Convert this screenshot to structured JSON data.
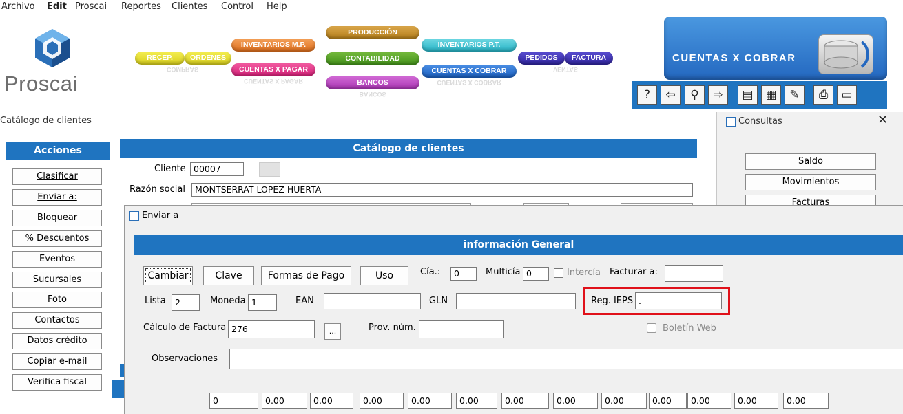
{
  "menu": [
    "Archivo",
    "Edit",
    "Proscai",
    "Reportes",
    "Clientes",
    "Control",
    "Help"
  ],
  "brand": "Proscai",
  "modules": {
    "recep": "RECEP.",
    "ordenes": "ORDENES",
    "compras": "COMPRAS",
    "inventarios_mp": "INVENTARIOS M.P.",
    "cuentas_pagar": "CUENTAS X PAGAR",
    "produccion": "PRODUCCIÓN",
    "contabilidad": "CONTABILIDAD",
    "bancos": "BANCOS",
    "inventarios_pt": "INVENTARIOS P.T.",
    "cuentas_cobrar": "CUENTAS X COBRAR",
    "pedidos": "PEDIDOS",
    "factura": "FACTURA",
    "ventas": "VENTAS",
    "big_module": "CUENTAS X COBRAR"
  },
  "toolbar_icons": [
    "help-icon",
    "arrow-left-icon",
    "search-icon",
    "arrow-right-icon",
    "list-icon",
    "edit-doc-icon",
    "pencil-icon",
    "print-icon",
    "window-icon"
  ],
  "window_title": "Catálogo de clientes",
  "actions": {
    "title": "Acciones",
    "items": [
      "Clasificar",
      "Enviar a:",
      "Bloquear",
      "% Descuentos",
      "Eventos",
      "Sucursales",
      "Foto",
      "Contactos",
      "Datos crédito",
      "Copiar e-mail",
      "Verifica fiscal"
    ]
  },
  "catalog": {
    "title": "Catálogo de clientes",
    "cliente_label": "Cliente",
    "cliente_value": "00007",
    "razon_label": "Razón social",
    "razon_value": "MONTSERRAT LOPEZ HUERTA"
  },
  "consultas": {
    "title": "Consultas",
    "items": [
      "Saldo",
      "Movimientos",
      "Facturas"
    ]
  },
  "dialog": {
    "title": "Enviar a",
    "section_title": "información General",
    "buttons": [
      "Cambiar",
      "Clave",
      "Formas de Pago",
      "Uso"
    ],
    "cia_label": "Cía.:",
    "cia_value": "0",
    "multicia_label": "Multicía",
    "multicia_value": "0",
    "intercia_label": "Intercía",
    "facturar_label": "Facturar a:",
    "facturar_value": "",
    "lista_label": "Lista",
    "lista_value": "2",
    "moneda_label": "Moneda",
    "moneda_value": "1",
    "ean_label": "EAN",
    "ean_value": "",
    "gln_label": "GLN",
    "gln_value": "",
    "reg_ieps_label": "Reg. IEPS",
    "reg_ieps_value": ".",
    "calculo_label": "Cálculo de Factura",
    "calculo_value": "276",
    "ellipsis": "...",
    "prov_label": "Prov. núm.",
    "prov_value": "",
    "boletin_label": "Boletín Web",
    "observaciones_label": "Observaciones",
    "observaciones_value": "",
    "bottom_values": [
      "0",
      "0.00",
      "0.00",
      "0.00",
      "0.00",
      "0.00",
      "0.00",
      "0.00",
      "0.00",
      "0.00",
      "0.00",
      "0.00",
      "0.00"
    ]
  },
  "colors": {
    "header_blue": "#1f74c0",
    "highlight_red": "#e0111a"
  }
}
